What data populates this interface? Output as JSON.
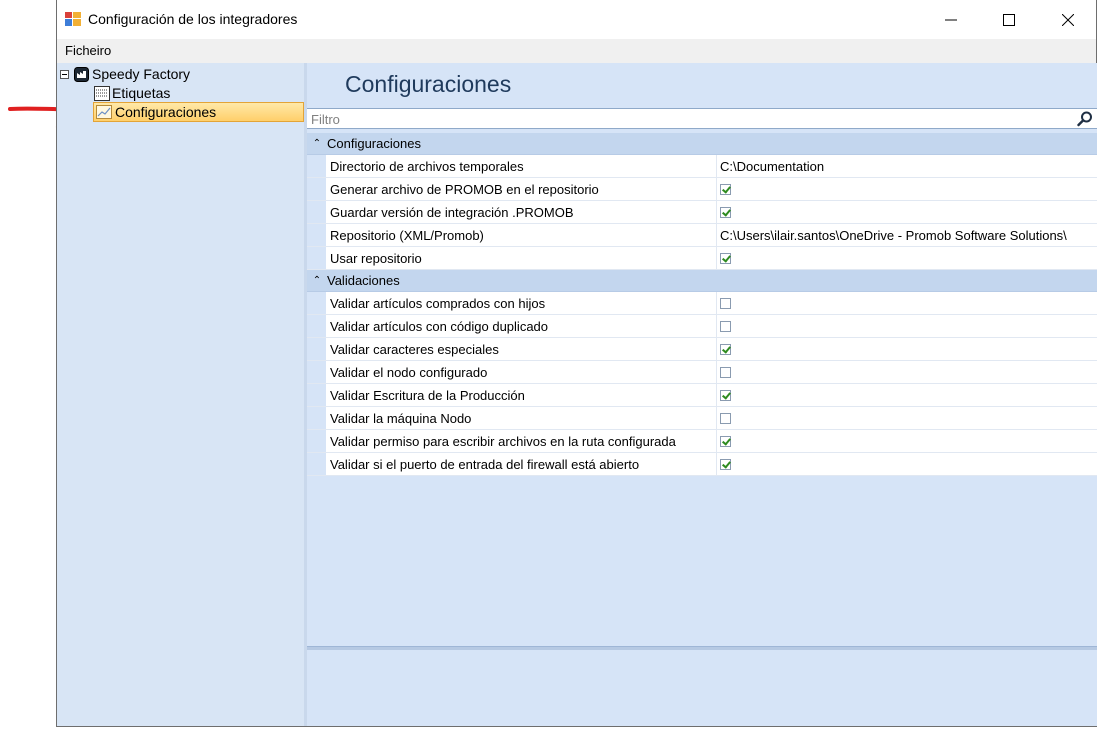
{
  "window": {
    "title": "Configuración de los integradores"
  },
  "menu": {
    "items": [
      "Ficheiro"
    ]
  },
  "tree": {
    "root": "Speedy Factory",
    "children": [
      {
        "label": "Etiquetas",
        "selected": false
      },
      {
        "label": "Configuraciones",
        "selected": true
      }
    ]
  },
  "main": {
    "title": "Configuraciones",
    "filter_placeholder": "Filtro",
    "categories": [
      {
        "name": "Configuraciones",
        "rows": [
          {
            "name": "Directorio de archivos temporales",
            "type": "text",
            "value": "C:\\Documentation"
          },
          {
            "name": "Generar archivo de PROMOB en el repositorio",
            "type": "bool",
            "value": true
          },
          {
            "name": "Guardar versión de integración .PROMOB",
            "type": "bool",
            "value": true
          },
          {
            "name": "Repositorio (XML/Promob)",
            "type": "text",
            "value": "C:\\Users\\ilair.santos\\OneDrive - Promob Software Solutions\\"
          },
          {
            "name": "Usar repositorio",
            "type": "bool",
            "value": true
          }
        ]
      },
      {
        "name": "Validaciones",
        "rows": [
          {
            "name": "Validar artículos comprados con hijos",
            "type": "bool",
            "value": false
          },
          {
            "name": "Validar artículos con código duplicado",
            "type": "bool",
            "value": false
          },
          {
            "name": "Validar caracteres especiales",
            "type": "bool",
            "value": true
          },
          {
            "name": "Validar el nodo configurado",
            "type": "bool",
            "value": false
          },
          {
            "name": "Validar Escritura de la Producción",
            "type": "bool",
            "value": true
          },
          {
            "name": "Validar la máquina Nodo",
            "type": "bool",
            "value": false
          },
          {
            "name": "Validar permiso para escribir archivos en la ruta configurada",
            "type": "bool",
            "value": true
          },
          {
            "name": "Validar si el puerto de entrada del firewall está abierto",
            "type": "bool",
            "value": true
          }
        ]
      }
    ]
  },
  "colors": {
    "accent_arrow": "#e02020",
    "selection": "#ffcf6a",
    "panel": "#d6e4f7"
  }
}
